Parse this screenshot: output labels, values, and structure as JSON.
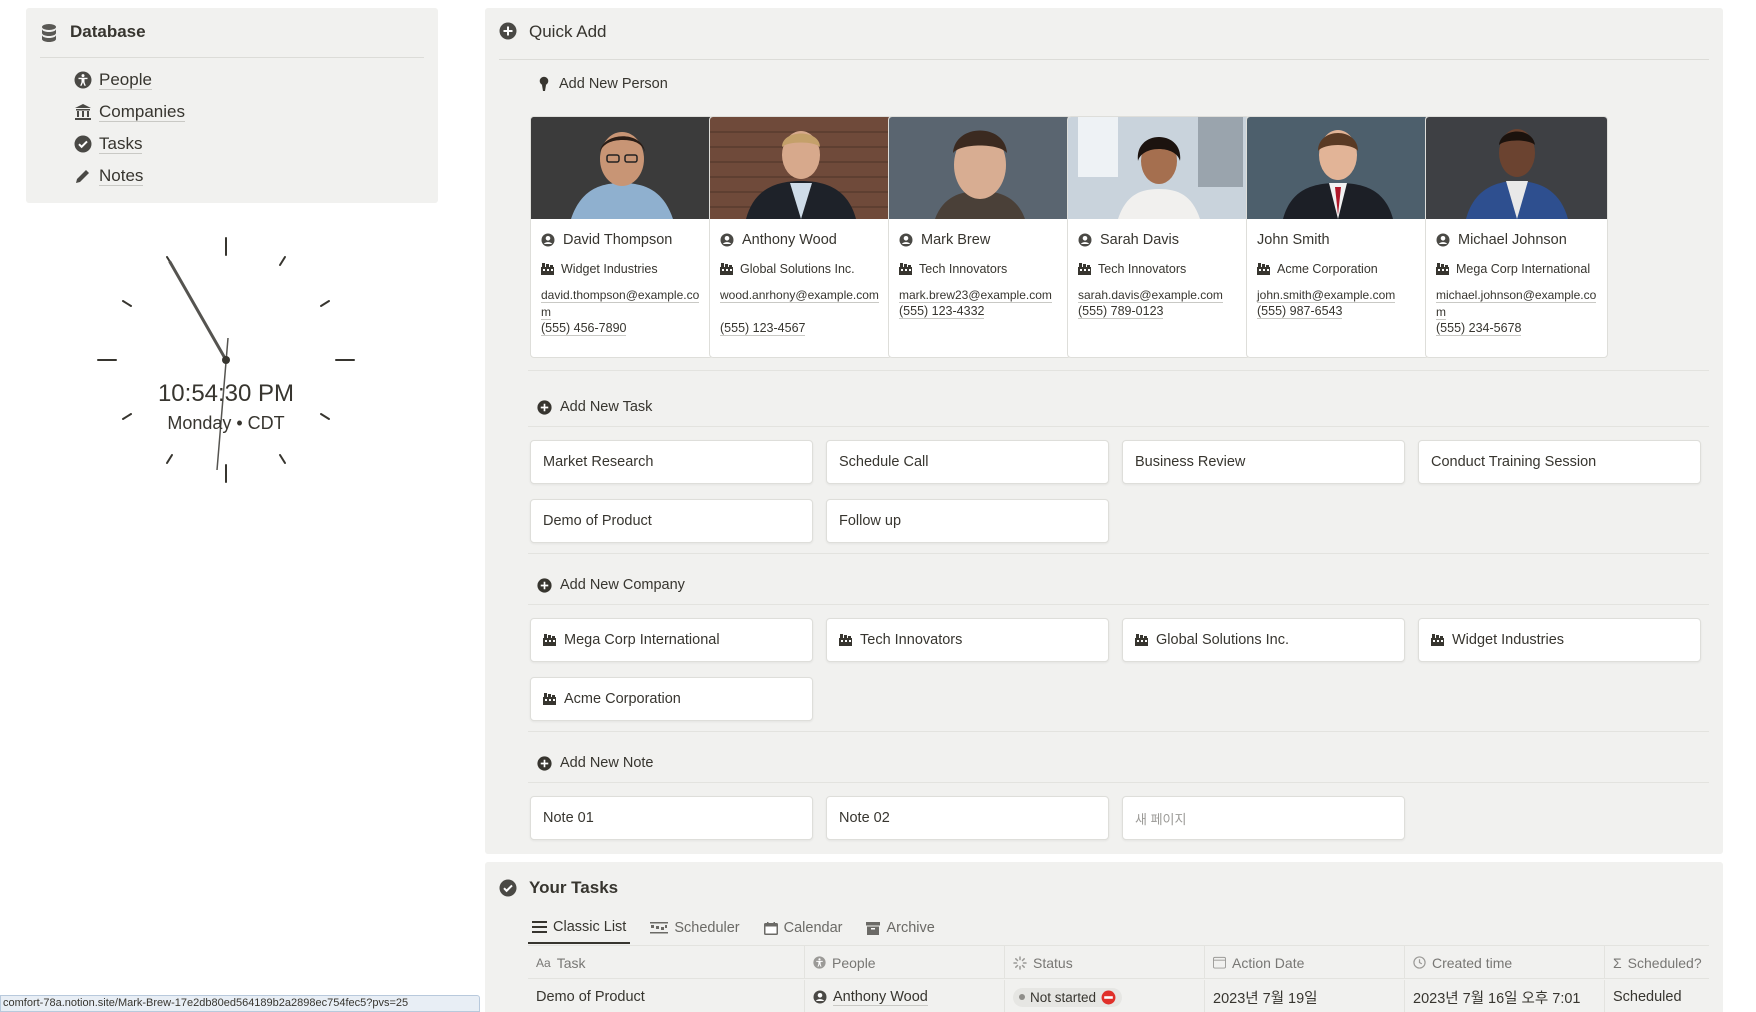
{
  "database": {
    "title": "Database",
    "items": [
      {
        "label": "People",
        "icon": "accessibility-icon"
      },
      {
        "label": "Companies",
        "icon": "bank-icon"
      },
      {
        "label": "Tasks",
        "icon": "check-circle-icon"
      },
      {
        "label": "Notes",
        "icon": "pencil-icon"
      }
    ]
  },
  "clock": {
    "time": "10:54:30 PM",
    "subtitle": "Monday • CDT"
  },
  "quick_add": {
    "title": "Quick Add",
    "person_section": "Add New Person",
    "people": [
      {
        "name": "David Thompson",
        "company": "Widget Industries",
        "email": "david.thompson@example.com",
        "phone": "(555) 456-7890"
      },
      {
        "name": "Anthony Wood",
        "company": "Global Solutions Inc.",
        "email": "wood.anrhony@example.com",
        "phone": "(555) 123-4567"
      },
      {
        "name": "Mark Brew",
        "company": "Tech Innovators",
        "email": "mark.brew23@example.com",
        "phone": "(555) 123-4332"
      },
      {
        "name": "Sarah Davis",
        "company": "Tech Innovators",
        "email": "sarah.davis@example.com",
        "phone": "(555) 789-0123"
      },
      {
        "name": "John Smith",
        "company": "Acme Corporation",
        "email": "john.smith@example.com",
        "phone": "(555) 987-6543"
      },
      {
        "name": "Michael Johnson",
        "company": "Mega Corp International",
        "email": "michael.johnson@example.com",
        "phone": "(555) 234-5678"
      }
    ],
    "task_section": "Add New Task",
    "tasks": [
      "Market Research",
      "Schedule Call",
      "Business Review",
      "Conduct Training Session",
      "Demo of Product",
      "Follow up"
    ],
    "company_section": "Add New Company",
    "companies": [
      "Mega Corp International",
      "Tech Innovators",
      "Global Solutions Inc.",
      "Widget Industries",
      "Acme Corporation"
    ],
    "note_section": "Add New Note",
    "notes": [
      "Note 01",
      "Note 02",
      "새 페이지"
    ]
  },
  "your_tasks": {
    "title": "Your Tasks",
    "views": [
      "Classic List",
      "Scheduler",
      "Calendar",
      "Archive"
    ],
    "columns": [
      "Task",
      "People",
      "Status",
      "Action Date",
      "Created time",
      "Scheduled?"
    ],
    "column_prefix_task": "Aa",
    "rows": [
      {
        "task": "Demo of Product",
        "people": "Anthony Wood",
        "status": "Not started",
        "action_date": "2023년 7월 19일",
        "created": "2023년 7월 16일 오후 7:01",
        "scheduled": "Scheduled"
      }
    ]
  },
  "status_url": "comfort-78a.notion.site/Mark-Brew-17e2db80ed564189b2a2898ec754fec5?pvs=25",
  "colors": {
    "panel_bg": "#f1f1ef",
    "text": "#37352f",
    "muted": "#787774",
    "status_not_started": "#e6e6e3"
  }
}
